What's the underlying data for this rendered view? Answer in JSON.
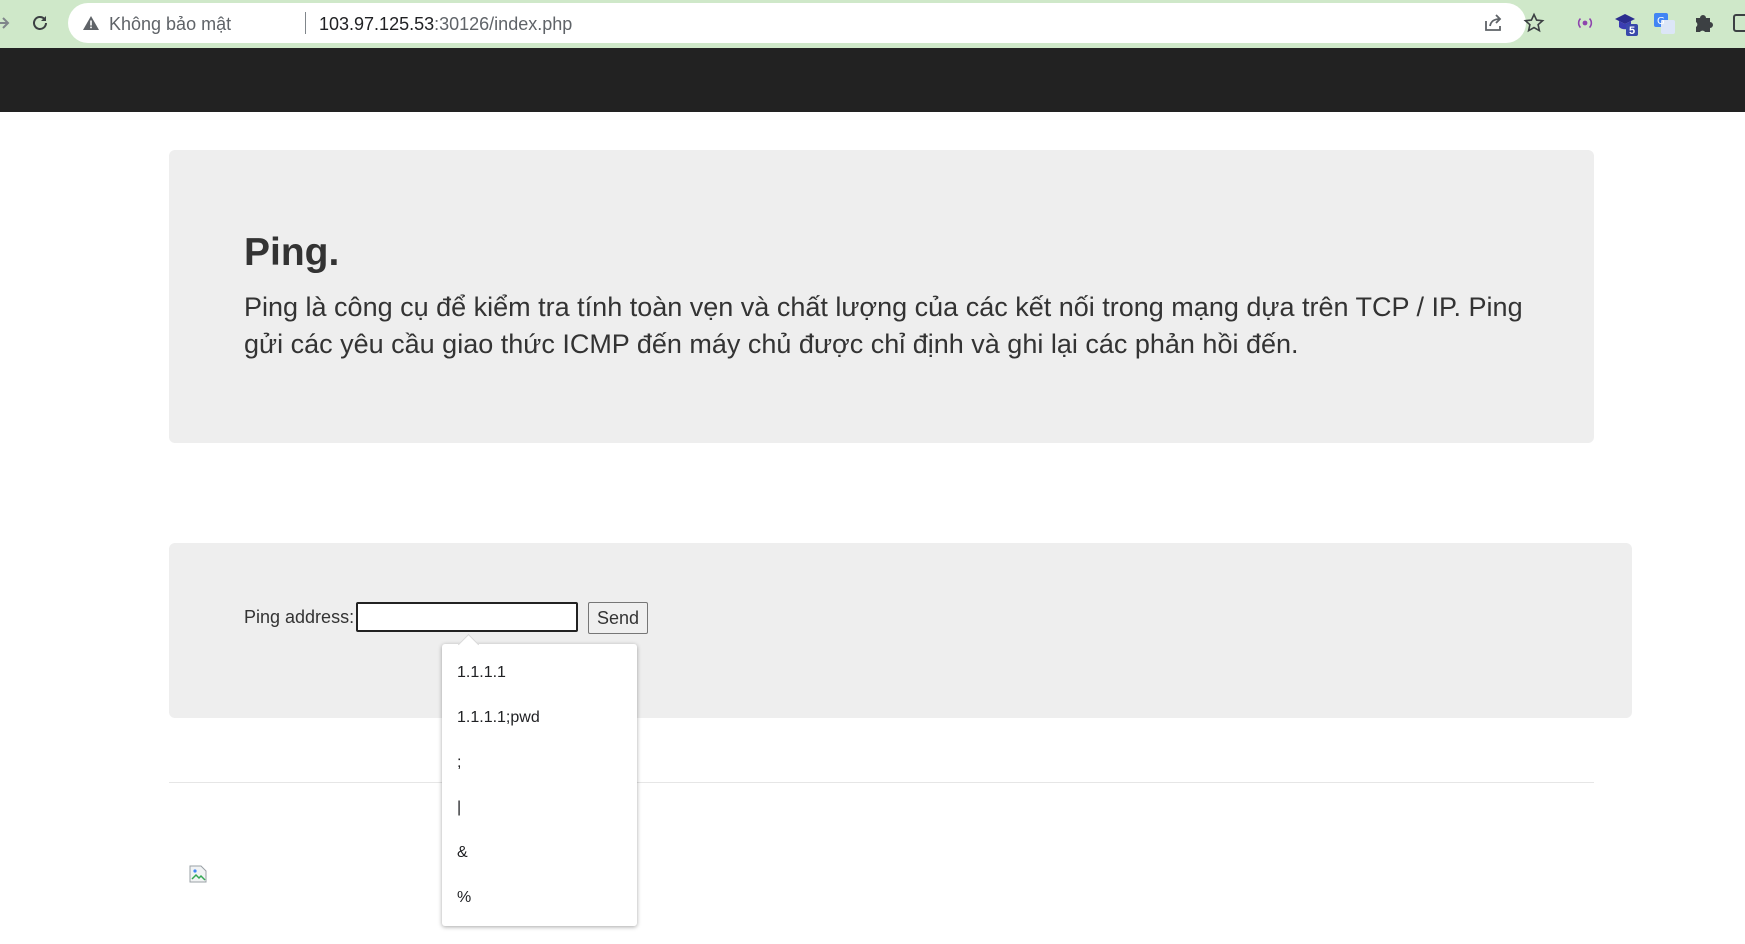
{
  "browser": {
    "security_label": "Không bảo mật",
    "url_host": "103.97.125.53",
    "url_path": ":30126/index.php",
    "extension_badge": "5",
    "colors": {
      "toolbar": "#cfe8c9",
      "omnibox": "#ffffff"
    }
  },
  "navbar": {
    "color": "#222222"
  },
  "jumbotron": {
    "title": "Ping.",
    "description": "Ping là công cụ để kiểm tra tính toàn vẹn và chất lượng của các kết nối trong mạng dựa trên TCP / IP. Ping gửi các yêu cầu giao thức ICMP đến máy chủ được chỉ định và ghi lại các phản hồi đến."
  },
  "form": {
    "label": "Ping address:",
    "input_value": "",
    "send_label": "Send"
  },
  "autocomplete": {
    "items": [
      "1.1.1.1",
      "1.1.1.1;pwd",
      ";",
      "|",
      "&",
      "%"
    ]
  }
}
